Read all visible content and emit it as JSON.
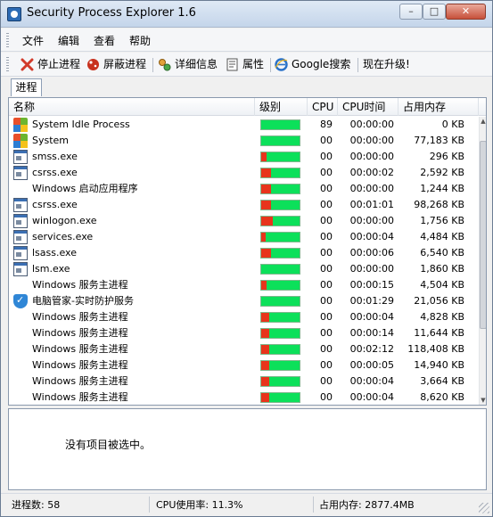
{
  "window": {
    "title": "Security Process Explorer 1.6"
  },
  "menu": [
    "文件",
    "编辑",
    "查看",
    "帮助"
  ],
  "toolbar": {
    "stop": "停止进程",
    "block": "屏蔽进程",
    "details": "详细信息",
    "props": "属性",
    "google": "Google搜索",
    "upgrade": "现在升级!"
  },
  "tab": {
    "label": "进程"
  },
  "columns": {
    "name": "名称",
    "level": "级别",
    "cpu": "CPU",
    "cputime": "CPU时间",
    "mem": "占用内存"
  },
  "processes": [
    {
      "name": "System Idle Process",
      "icon": "windows-icon",
      "risk": 0,
      "cpu": "89",
      "time": "00:00:00",
      "mem": "0 KB"
    },
    {
      "name": "System",
      "icon": "windows-icon",
      "risk": 0,
      "cpu": "00",
      "time": "00:00:00",
      "mem": "77,183 KB"
    },
    {
      "name": "smss.exe",
      "icon": "exe-icon",
      "risk": 0.15,
      "cpu": "00",
      "time": "00:00:00",
      "mem": "296 KB"
    },
    {
      "name": "csrss.exe",
      "icon": "exe-icon",
      "risk": 0.25,
      "cpu": "00",
      "time": "00:00:02",
      "mem": "2,592 KB"
    },
    {
      "name": "Windows 启动应用程序",
      "icon": "none",
      "risk": 0.25,
      "cpu": "00",
      "time": "00:00:00",
      "mem": "1,244 KB"
    },
    {
      "name": "csrss.exe",
      "icon": "exe-icon",
      "risk": 0.25,
      "cpu": "00",
      "time": "00:01:01",
      "mem": "98,268 KB"
    },
    {
      "name": "winlogon.exe",
      "icon": "exe-icon",
      "risk": 0.3,
      "cpu": "00",
      "time": "00:00:00",
      "mem": "1,756 KB"
    },
    {
      "name": "services.exe",
      "icon": "exe-icon",
      "risk": 0.12,
      "cpu": "00",
      "time": "00:00:04",
      "mem": "4,484 KB"
    },
    {
      "name": "lsass.exe",
      "icon": "exe-icon",
      "risk": 0.25,
      "cpu": "00",
      "time": "00:00:06",
      "mem": "6,540 KB"
    },
    {
      "name": "lsm.exe",
      "icon": "exe-icon",
      "risk": 0,
      "cpu": "00",
      "time": "00:00:00",
      "mem": "1,860 KB"
    },
    {
      "name": "Windows 服务主进程",
      "icon": "none",
      "risk": 0.15,
      "cpu": "00",
      "time": "00:00:15",
      "mem": "4,504 KB"
    },
    {
      "name": "电脑管家-实时防护服务",
      "icon": "shield-icon",
      "risk": 0,
      "cpu": "00",
      "time": "00:01:29",
      "mem": "21,056 KB"
    },
    {
      "name": "Windows 服务主进程",
      "icon": "none",
      "risk": 0.2,
      "cpu": "00",
      "time": "00:00:04",
      "mem": "4,828 KB"
    },
    {
      "name": "Windows 服务主进程",
      "icon": "none",
      "risk": 0.2,
      "cpu": "00",
      "time": "00:00:14",
      "mem": "11,644 KB"
    },
    {
      "name": "Windows 服务主进程",
      "icon": "none",
      "risk": 0.2,
      "cpu": "00",
      "time": "00:02:12",
      "mem": "118,408 KB"
    },
    {
      "name": "Windows 服务主进程",
      "icon": "none",
      "risk": 0.2,
      "cpu": "00",
      "time": "00:00:05",
      "mem": "14,940 KB"
    },
    {
      "name": "Windows 服务主进程",
      "icon": "none",
      "risk": 0.2,
      "cpu": "00",
      "time": "00:00:04",
      "mem": "3,664 KB"
    },
    {
      "name": "Windows 服务主进程",
      "icon": "none",
      "risk": 0.2,
      "cpu": "00",
      "time": "00:00:04",
      "mem": "8,620 KB"
    }
  ],
  "detail": {
    "empty": "没有项目被选中。"
  },
  "status": {
    "count": "进程数: 58",
    "cpu": "CPU使用率: 11.3%",
    "mem": "占用内存: 2877.4MB"
  },
  "colors": {
    "risk": "#e8341c",
    "safe": "#0ce05a"
  }
}
